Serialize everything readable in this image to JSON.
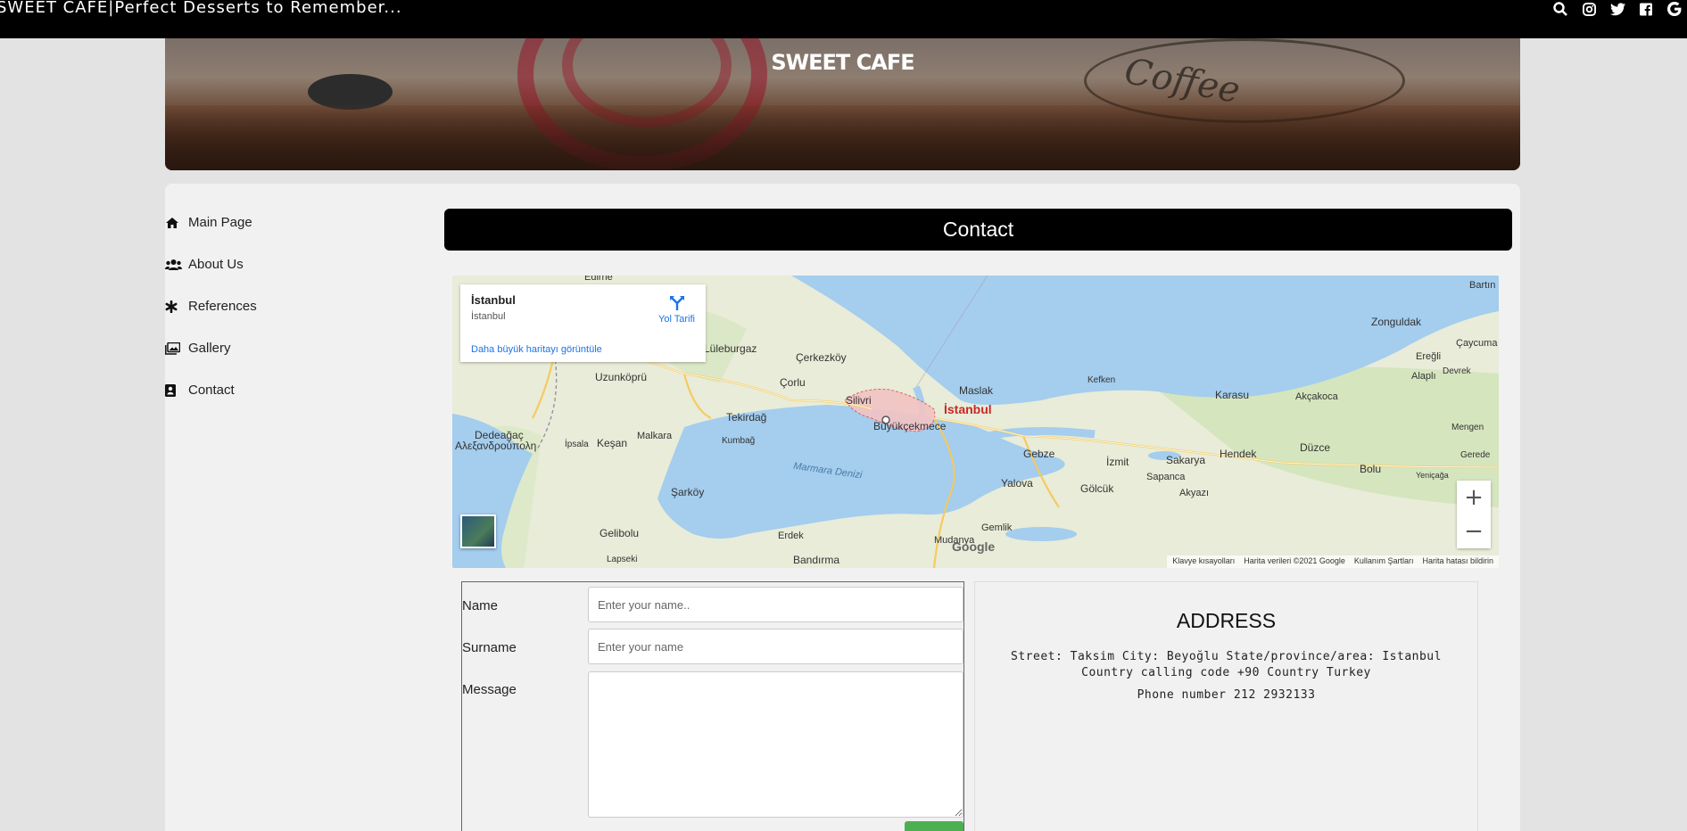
{
  "topbar": {
    "brand": "SWEET CAFE|Perfect Desserts to Remember...",
    "icons": [
      "search-icon",
      "instagram-icon",
      "twitter-icon",
      "facebook-icon",
      "google-icon"
    ]
  },
  "hero": {
    "title": "SWEET CAFE",
    "badge_text": "Coffee"
  },
  "sidebar": {
    "items": [
      {
        "label": "Main Page",
        "icon": "home-icon"
      },
      {
        "label": "About Us",
        "icon": "users-icon"
      },
      {
        "label": "References",
        "icon": "asterisk-icon"
      },
      {
        "label": "Gallery",
        "icon": "images-icon"
      },
      {
        "label": "Contact",
        "icon": "address-book-icon"
      }
    ]
  },
  "contact": {
    "title": "Contact"
  },
  "map": {
    "place_name": "İstanbul",
    "place_address": "İstanbul",
    "directions_label": "Yol Tarifi",
    "larger_map_link": "Daha büyük haritayı görüntüle",
    "zoom_in": "+",
    "zoom_out": "−",
    "logo": "Google",
    "attribution": {
      "shortcuts": "Klavye kısayolları",
      "data": "Harita verileri ©2021 Google",
      "terms": "Kullanım Şartları",
      "report": "Harita hatası bildirin"
    },
    "labels": {
      "edirne": "Edirne",
      "bartin": "Bartın",
      "zonguldak": "Zonguldak",
      "eregli": "Ereğli",
      "caycuma": "Çaycuma",
      "devrek": "Devrek",
      "alapli": "Alaplı",
      "luleburgaz": "Lüleburgaz",
      "cerkezkoy": "Çerkezköy",
      "uzunkopru": "Uzunköprü",
      "corlu": "Çorlu",
      "silivri": "Silivri",
      "maslak": "Maslak",
      "istanbul": "İstanbul",
      "kefken": "Kefken",
      "karasu": "Karasu",
      "akcakoca": "Akçakoca",
      "mengen": "Mengen",
      "tekirdag": "Tekirdağ",
      "buyukcekmece": "Büyükçekmece",
      "dedeagac": "Dedeağaç",
      "alexandroupoli": "Αλεξανδρούπολη",
      "ipsala": "İpsala",
      "kesan": "Keşan",
      "malkara": "Malkara",
      "kumbag": "Kumbağ",
      "gebze": "Gebze",
      "izmit": "İzmit",
      "sakarya": "Sakarya",
      "hendek": "Hendek",
      "duzce": "Düzce",
      "bolu": "Bolu",
      "gerede": "Gerede",
      "yenicaga": "Yeniçağa",
      "marmara_denizi": "Marmara Denizi",
      "sarkoy": "Şarköy",
      "sapanca": "Sapanca",
      "yalova": "Yalova",
      "golcuk": "Gölcük",
      "akyazi": "Akyazı",
      "gelibolu": "Gelibolu",
      "erdek": "Erdek",
      "gemlik": "Gemlik",
      "lapseki": "Lapseki",
      "bandirma": "Bandırma",
      "mudanya": "Mudanya"
    }
  },
  "form": {
    "name_label": "Name",
    "name_placeholder": "Enter your name..",
    "surname_label": "Surname",
    "surname_placeholder": "Enter your name",
    "message_label": "Message",
    "submit_color": "#4caf50"
  },
  "address": {
    "heading": "ADDRESS",
    "street": "Street: Taksim City: Beyoğlu State/province/area: Istanbul Country calling code +90 Country Turkey",
    "phone": "Phone number 212 2932133"
  }
}
